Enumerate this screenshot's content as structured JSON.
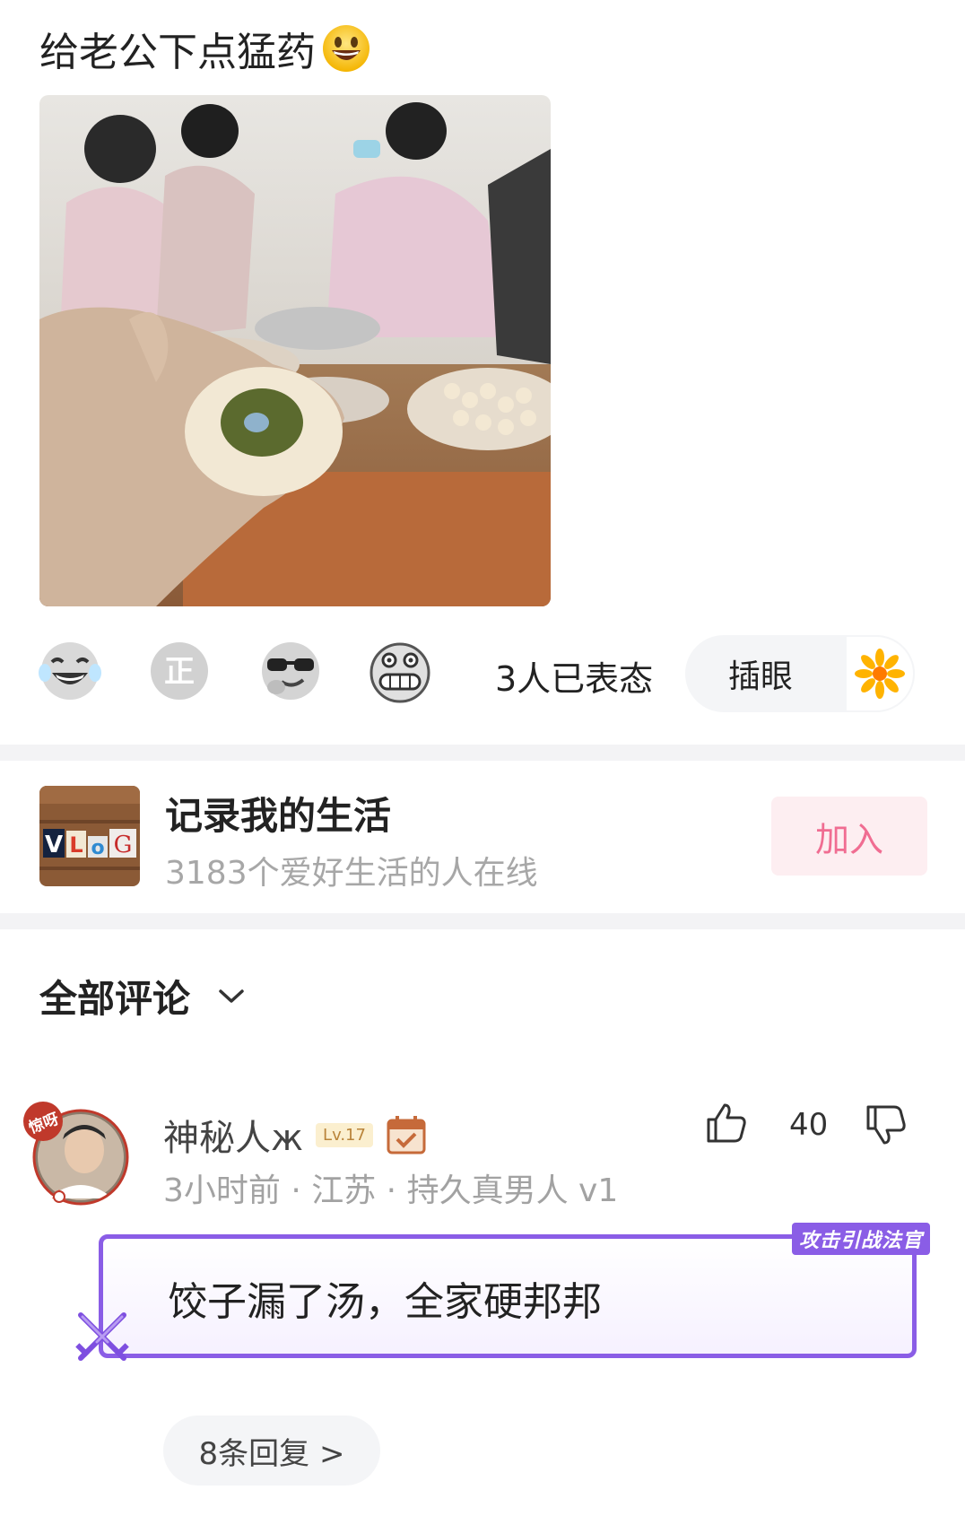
{
  "post": {
    "title": "给老公下点猛药"
  },
  "reactions": {
    "count_text": "3人已表态",
    "chip_label": "插眼",
    "icons": [
      "laugh-tears-icon",
      "zheng-icon",
      "sunglasses-icon",
      "grimace-icon",
      "flower-icon"
    ]
  },
  "group": {
    "name": "记录我的生活",
    "online": "3183个爱好生活的人在线",
    "join_label": "加入",
    "thumb_text": "VLoG"
  },
  "comments": {
    "header": "全部评论",
    "items": [
      {
        "avatar_badge": "惊呀",
        "username": "神秘人ж",
        "level": "Lv.17",
        "meta": "3小时前 · 江苏 · 持久真男人 v1",
        "likes": "40",
        "text": "饺子漏了汤，全家硬邦邦",
        "tag": "攻击引战法官",
        "replies_label": "8条回复 >"
      }
    ]
  },
  "colors": {
    "accent_pink": "#f06d92",
    "bubble_purple": "#8a5de6",
    "separator": "#f3f3f5"
  }
}
